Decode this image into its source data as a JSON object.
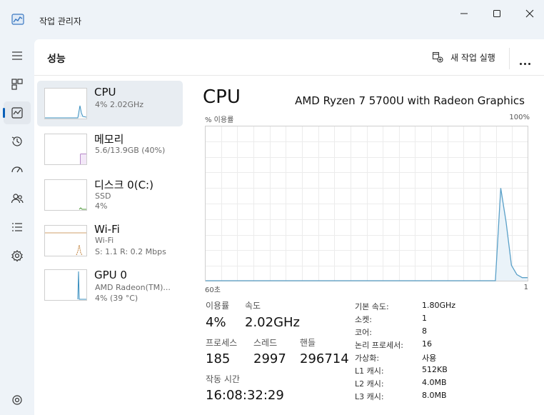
{
  "app": {
    "title": "작업 관리자"
  },
  "header": {
    "page_title": "성능",
    "new_task_label": "새 작업 실행"
  },
  "nav_icons": [
    "hamburger-icon",
    "processes-icon",
    "performance-icon",
    "app-history-icon",
    "startup-apps-icon",
    "users-icon",
    "details-icon",
    "services-icon",
    "settings-icon"
  ],
  "devices": [
    {
      "name": "CPU",
      "lines": [
        "4% 2.02GHz"
      ]
    },
    {
      "name": "메모리",
      "lines": [
        "5.6/13.9GB (40%)"
      ]
    },
    {
      "name": "디스크 0(C:)",
      "lines": [
        "SSD",
        "4%"
      ]
    },
    {
      "name": "Wi-Fi",
      "lines": [
        "Wi-Fi",
        "S: 1.1  R: 0.2 Mbps"
      ]
    },
    {
      "name": "GPU 0",
      "lines": [
        "AMD Radeon(TM)...",
        "4% (39 °C)"
      ]
    }
  ],
  "cpu": {
    "title": "CPU",
    "model": "AMD Ryzen 7 5700U with Radeon Graphics",
    "axis_top_left": "% 이용률",
    "axis_top_right": "100%",
    "axis_bottom_left": "60초",
    "axis_bottom_right": "1"
  },
  "chart_data": {
    "type": "area",
    "xlabel": "60초",
    "ylabel": "% 이용률",
    "xlim": [
      60,
      0
    ],
    "ylim": [
      0,
      100
    ],
    "grid": true,
    "color": "#5aa0c8",
    "x": [
      60,
      6,
      5,
      4,
      3,
      2,
      1,
      0
    ],
    "values": [
      0,
      0,
      60,
      38,
      10,
      4,
      2,
      2
    ]
  },
  "stats": {
    "utilization_label": "이용률",
    "utilization_value": "4%",
    "speed_label": "속도",
    "speed_value": "2.02GHz",
    "processes_label": "프로세스",
    "processes_value": "185",
    "threads_label": "스레드",
    "threads_value": "2997",
    "handles_label": "핸들",
    "handles_value": "296714",
    "uptime_label": "작동 시간",
    "uptime_value": "16:08:32:29"
  },
  "specs": [
    {
      "k": "기본 속도:",
      "v": "1.80GHz"
    },
    {
      "k": "소켓:",
      "v": "1"
    },
    {
      "k": "코어:",
      "v": "8"
    },
    {
      "k": "논리 프로세서:",
      "v": "16"
    },
    {
      "k": "가상화:",
      "v": "사용"
    },
    {
      "k": "L1 캐시:",
      "v": "512KB"
    },
    {
      "k": "L2 캐시:",
      "v": "4.0MB"
    },
    {
      "k": "L3 캐시:",
      "v": "8.0MB"
    }
  ]
}
